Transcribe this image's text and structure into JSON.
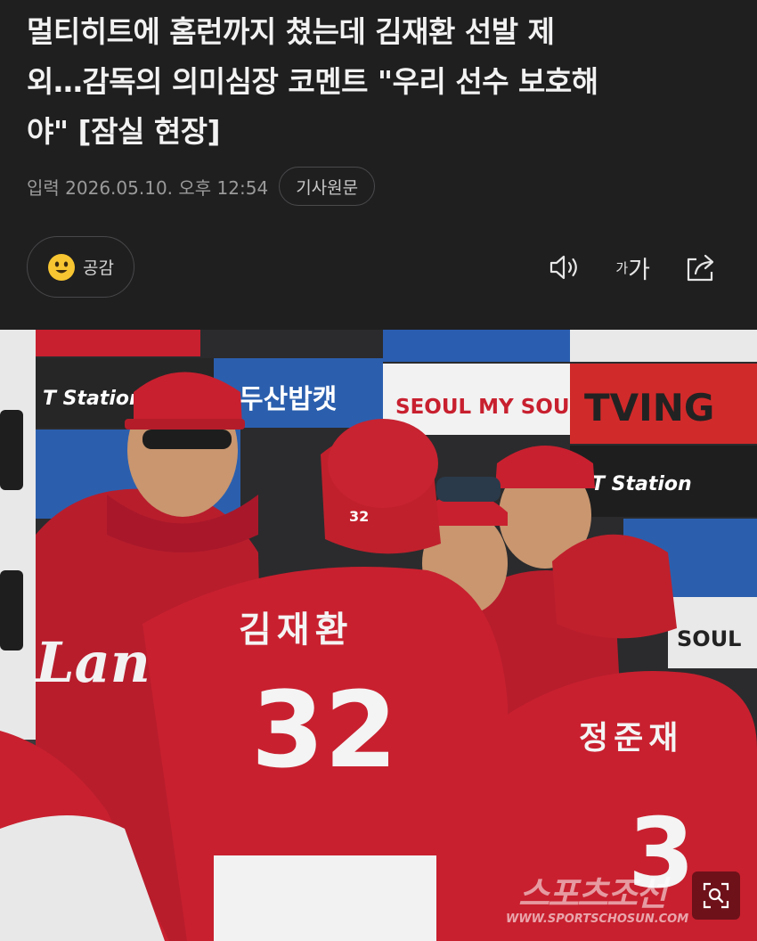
{
  "article": {
    "headline_lines": [
      "멀티히트에 홈런까지 쳤는데 김재환 선발 제",
      "외…감독의 의미심장 코멘트 \"우리 선수 보호해",
      "야\" [잠실 현장]"
    ],
    "date_label": "입력 2026.05.10. 오후 12:54",
    "source_chip": "기사원문"
  },
  "actions": {
    "empathy_label": "공감",
    "font_small": "가",
    "font_large": "가"
  },
  "icons": [
    "smile-emoji-icon",
    "speaker-icon",
    "font-size-icon",
    "share-icon",
    "zoom-icon"
  ],
  "photo": {
    "signs": [
      "T Station",
      "두산밥캣",
      "SEOUL MY SOUL",
      "TVING",
      "SOUL"
    ],
    "player_left_name": "김재환",
    "player_left_number": "32",
    "player_right_name": "정준재",
    "player_right_number": "3",
    "jersey_logo": "Landers",
    "watermark": "스포츠조선",
    "watermark_url": "WWW.SPORTSCHOSUN.COM"
  },
  "colors": {
    "background": "#1f1f20",
    "jersey_red": "#c8202f",
    "text_primary": "#f2f2f2",
    "text_secondary": "#9a9a9a"
  }
}
